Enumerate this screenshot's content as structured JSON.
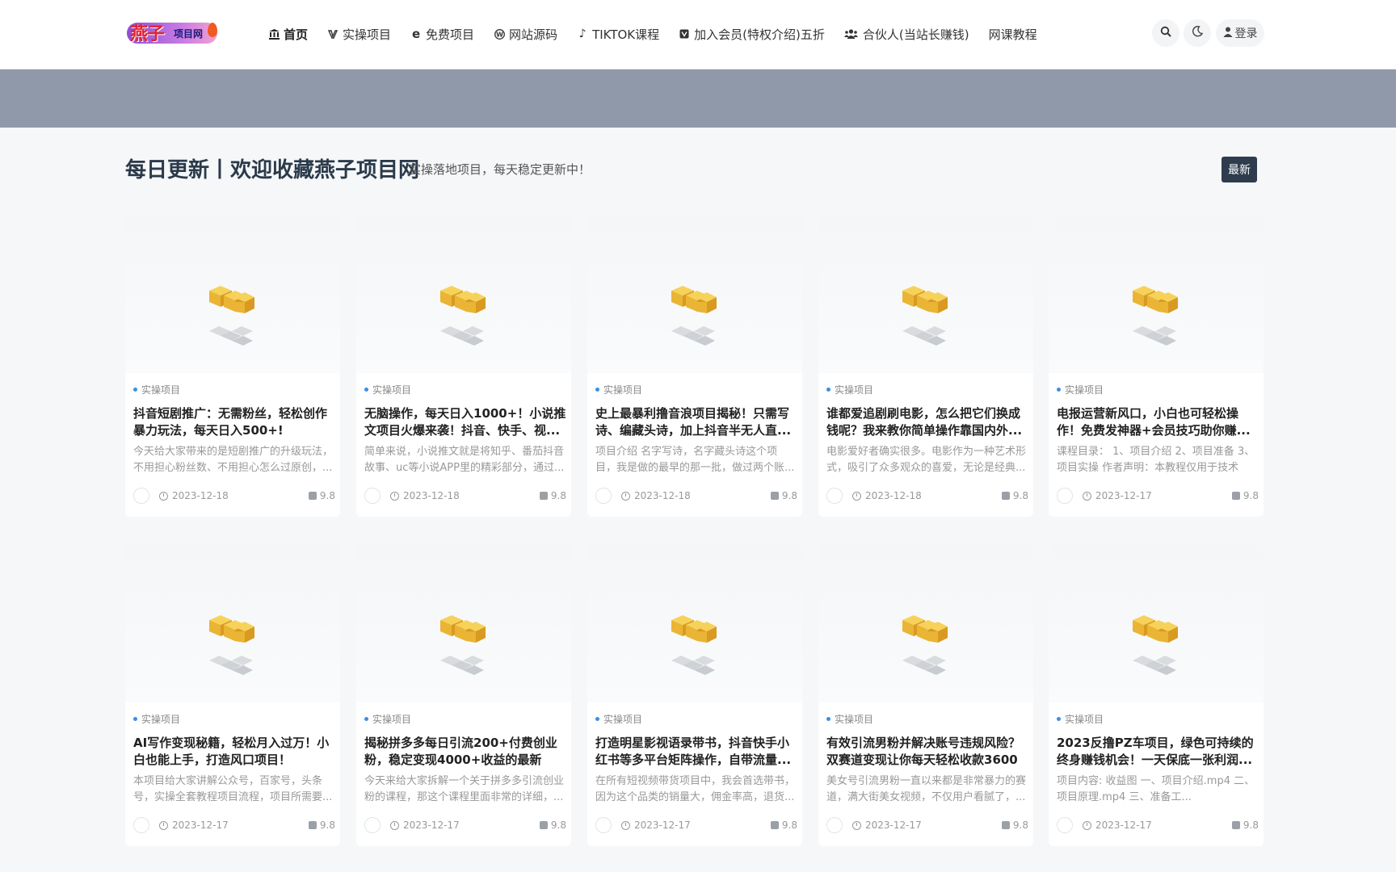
{
  "header": {
    "logo": {
      "text_main": "燕子",
      "text_sub": "项目网"
    },
    "nav": [
      {
        "label": "首页",
        "icon": "bank-icon",
        "glyph": "🏛"
      },
      {
        "label": "实操项目",
        "icon": "vimeo-icon",
        "glyph": "V"
      },
      {
        "label": "免费项目",
        "icon": "edge-icon",
        "glyph": "e"
      },
      {
        "label": "网站源码",
        "icon": "wordpress-icon",
        "glyph": "W"
      },
      {
        "label": "TIKTOK课程",
        "icon": "tiktok-icon",
        "glyph": "♪"
      },
      {
        "label": "加入会员(特权介绍)五折",
        "icon": "vk-icon",
        "glyph": "V"
      },
      {
        "label": "合伙人(当站长赚钱)",
        "icon": "users-icon",
        "glyph": "👥"
      },
      {
        "label": "网课教程",
        "icon": "",
        "glyph": ""
      }
    ],
    "search_icon": "search-icon",
    "theme_icon": "moon-icon",
    "login_label": "登录",
    "login_icon": "user-icon"
  },
  "section": {
    "title": "每日更新丨欢迎收藏燕子项目网",
    "subtitle": "实操落地项目，每天稳定更新中！",
    "sort_button": "最新"
  },
  "cards": [
    {
      "category": "实操项目",
      "title": "抖音短剧推广：无需粉丝，轻松创作暴力玩法，每天日入500+!",
      "desc": "今天给大家带来的是短剧推广的升级玩法，不用担心粉丝数、不用担心怎么过原创，...",
      "date": "2023-12-18",
      "score": "9.8"
    },
    {
      "category": "实操项目",
      "title": "无脑操作，每天日入1000+！小说推文项目火爆来袭！抖音、快手、视...",
      "desc": "简单来说，小说推文就是将知乎、番茄抖音故事、uc等小说APP里的精彩部分，通过...",
      "date": "2023-12-18",
      "score": "9.8"
    },
    {
      "category": "实操项目",
      "title": "史上最暴利撸音浪项目揭秘！只需写诗、编藏头诗，加上抖音半无人直...",
      "desc": "项目介绍 名字写诗，名字藏头诗这个项目，我是做的最早的那一批，做过两个账...",
      "date": "2023-12-18",
      "score": "9.8"
    },
    {
      "category": "实操项目",
      "title": "谁都爱追剧刷电影，怎么把它们换成钱呢？我来教你简单操作靠国内外...",
      "desc": "电影爱好者确实很多。电影作为一种艺术形式，吸引了众多观众的喜爱，无论是经典...",
      "date": "2023-12-18",
      "score": "9.8"
    },
    {
      "category": "实操项目",
      "title": "电报运营新风口，小白也可轻松操作！免费发神器+会员技巧助你赚...",
      "desc": "课程目录： 1、项目介绍 2、项目准备 3、项目实操 作者声明：本教程仅用于技术交...",
      "date": "2023-12-17",
      "score": "9.8"
    },
    {
      "category": "实操项目",
      "title": "AI写作变现秘籍，轻松月入过万！小白也能上手，打造风口项目！",
      "desc": "本项目给大家讲解公众号，百家号，头条号，实操全套教程项目流程，项目所需要...",
      "date": "2023-12-17",
      "score": "9.8"
    },
    {
      "category": "实操项目",
      "title": "揭秘拼多多每日引流200+付费创业粉，稳定变现4000+收益的最新教...",
      "desc": "今天来给大家拆解一个关于拼多多引流创业粉的课程，那这个课程里面非常的详细，...",
      "date": "2023-12-17",
      "score": "9.8"
    },
    {
      "category": "实操项目",
      "title": "打造明星影视语录带书，抖音快手小红书等多平台矩阵操作，自带流量...",
      "desc": "在所有短视频带货项目中，我会首选带书，因为这个品类的销量大，佣金率高，退货...",
      "date": "2023-12-17",
      "score": "9.8"
    },
    {
      "category": "实操项目",
      "title": "有效引流男粉并解决账号违规风险？双赛道变现让你每天轻松收款3600元",
      "desc": "美女号引流男粉一直以来都是非常暴力的赛道，满大街美女视频，不仅用户看腻了，...",
      "date": "2023-12-17",
      "score": "9.8"
    },
    {
      "category": "实操项目",
      "title": "2023反撸PZ车项目，绿色可持续的终身赚钱机会！一天保底一张利润...",
      "desc": "项目内容: 收益图 一、项目介绍.mp4 二、项目原理.mp4 三、准备工...",
      "date": "2023-12-17",
      "score": "9.8"
    }
  ],
  "colors": {
    "banner": "#9099a9",
    "sort_button": "#2e3c4e",
    "category_dot": "#3a8ee6",
    "placeholder_orange": "#f0b93b"
  }
}
